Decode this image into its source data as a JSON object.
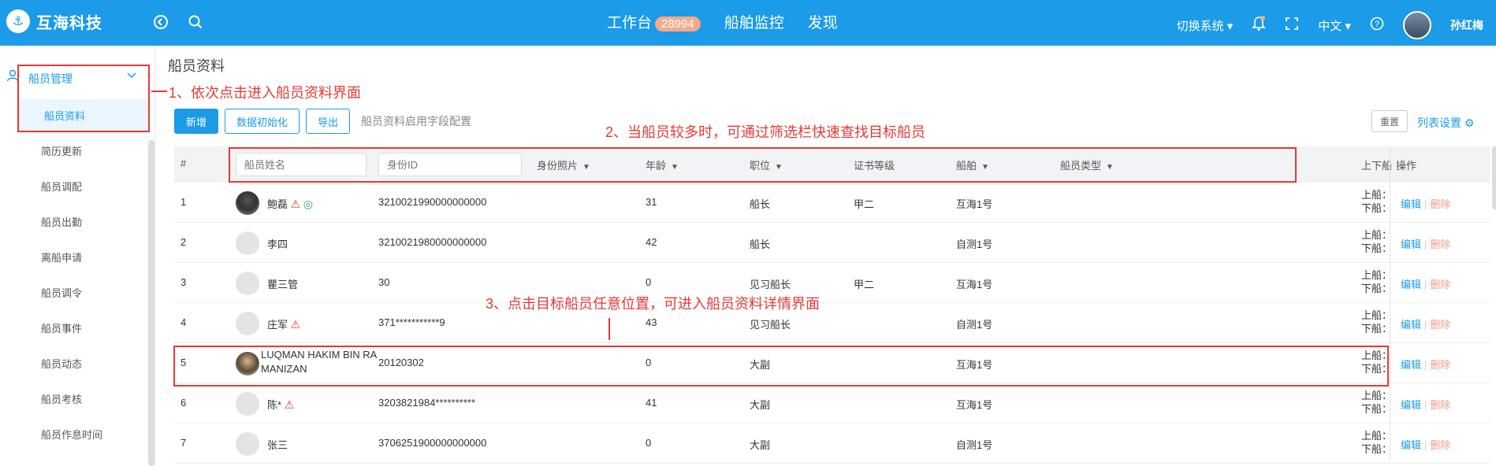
{
  "header": {
    "logo_mark": "⚓",
    "brand": "互海科技",
    "nav": [
      {
        "label": "工作台",
        "badge": "28994"
      },
      {
        "label": "船舶监控"
      },
      {
        "label": "发现"
      }
    ],
    "switch_system": "切换系统 ▾",
    "language": "中文 ▾",
    "username": "孙红梅"
  },
  "sidebar": {
    "group_label": "船员管理",
    "items": [
      "船员资料",
      "简历更新",
      "船员调配",
      "船员出勤",
      "离船申请",
      "船员调令",
      "船员事件",
      "船员动态",
      "船员考核",
      "船员作息时间"
    ]
  },
  "page": {
    "title": "船员资料",
    "buttons": {
      "add": "新增",
      "init": "数据初始化",
      "export": "导出"
    },
    "field_config_link": "船员资料启用字段配置",
    "reset": "重置",
    "list_settings": "列表设置 ⚙"
  },
  "table": {
    "headers": {
      "index": "#",
      "name_placeholder": "船员姓名",
      "id_placeholder": "身份ID",
      "photo": "身份照片",
      "age": "年龄",
      "position": "职位",
      "cert": "证书等级",
      "ship": "船舶",
      "crew_type": "船员类型",
      "onoff": "上下船",
      "ops": "操作"
    },
    "rows": [
      {
        "idx": "1",
        "name": "鲍磊",
        "id": "3210021990000000000",
        "age": "31",
        "position": "船长",
        "cert": "甲二",
        "ship": "互海1号",
        "on": "上船：",
        "off": "下船："
      },
      {
        "idx": "2",
        "name": "李四",
        "id": "3210021980000000000",
        "age": "42",
        "position": "船长",
        "cert": "",
        "ship": "自测1号",
        "on": "上船：",
        "off": "下船："
      },
      {
        "idx": "3",
        "name": "瞿三管",
        "id": "30",
        "age": "0",
        "position": "见习船长",
        "cert": "甲二",
        "ship": "互海1号",
        "on": "上船：",
        "off": "下船："
      },
      {
        "idx": "4",
        "name": "庄军",
        "id": "371***********9",
        "age": "43",
        "position": "见习船长",
        "cert": "",
        "ship": "自测1号",
        "on": "上船：",
        "off": "下船："
      },
      {
        "idx": "5",
        "name": "LUQMAN HAKIM BIN RA",
        "name2": "MANIZAN",
        "id": "20120302",
        "age": "0",
        "position": "大副",
        "cert": "",
        "ship": "互海1号",
        "on": "上船：",
        "off": "下船："
      },
      {
        "idx": "6",
        "name": "陈*",
        "id": "3203821984**********",
        "age": "41",
        "position": "大副",
        "cert": "",
        "ship": "互海1号",
        "on": "上船：",
        "off": "下船："
      },
      {
        "idx": "7",
        "name": "张三",
        "id": "3706251900000000000",
        "age": "0",
        "position": "大副",
        "cert": "",
        "ship": "自测1号",
        "on": "上船：",
        "off": "下船："
      }
    ],
    "op_edit": "编辑",
    "op_sep": "|",
    "op_delete": "删除"
  },
  "annotations": {
    "a1": "1、依次点击进入船员资料界面",
    "a2": "2、当船员较多时，可通过筛选栏快速查找目标船员",
    "a3": "3、点击目标船员任意位置，可进入船员资料详情界面"
  },
  "icons": {
    "warn": "⚠",
    "green": "◎",
    "back": "◀",
    "search": "⌕",
    "bell": "🔔",
    "expand": "⤢",
    "help": "?",
    "user": "👤",
    "chevron": "⌄"
  }
}
